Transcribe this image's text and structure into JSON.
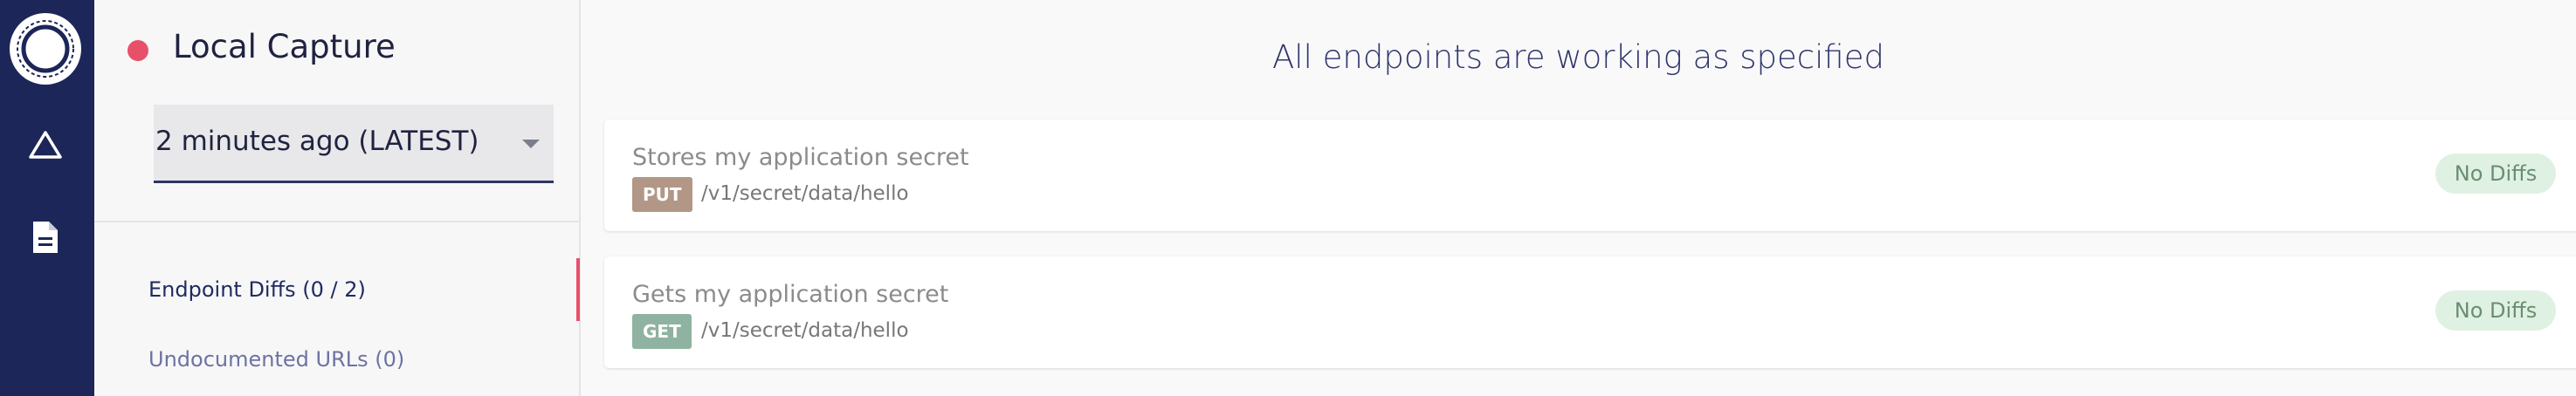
{
  "rail": {
    "icons": [
      "app-logo-icon",
      "triangle-icon",
      "document-icon"
    ],
    "accent_color": "#1c2658"
  },
  "sidebar": {
    "capture_title": "Local Capture",
    "status_color": "#e8506a",
    "capture_select": {
      "value": "2 minutes ago (LATEST)"
    },
    "nav": [
      {
        "label": "Endpoint Diffs (0 / 2)",
        "active": true
      },
      {
        "label": "Undocumented URLs (0)",
        "active": false
      }
    ]
  },
  "main": {
    "heading": "All endpoints are working as specified",
    "endpoints": [
      {
        "title": "Stores my application secret",
        "method": "PUT",
        "path": "/v1/secret/data/hello",
        "status": "No Diffs"
      },
      {
        "title": "Gets my application secret",
        "method": "GET",
        "path": "/v1/secret/data/hello",
        "status": "No Diffs"
      }
    ]
  }
}
